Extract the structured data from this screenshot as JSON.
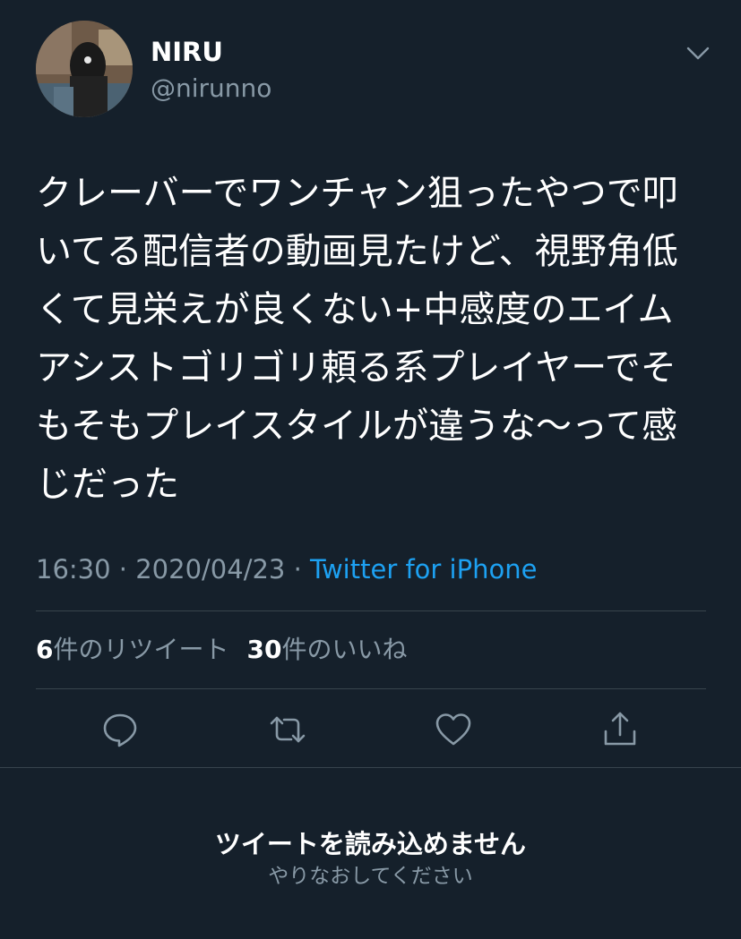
{
  "author": {
    "display_name": "NIRU",
    "handle": "@nirunno"
  },
  "tweet": {
    "text": "クレーバーでワンチャン狙ったやつで叩いてる配信者の動画見たけど、視野角低くて見栄えが良くない+中感度のエイムアシストゴリゴリ頼る系プレイヤーでそもそもプレイスタイルが違うな〜って感じだった",
    "time": "16:30",
    "separator": " · ",
    "date": "2020/04/23",
    "source": "Twitter for iPhone"
  },
  "stats": {
    "retweet_count": "6",
    "retweet_label": "件のリツイート",
    "like_count": "30",
    "like_label": "件のいいね"
  },
  "actions": {
    "reply_icon": "reply-icon",
    "retweet_icon": "retweet-icon",
    "like_icon": "heart-icon",
    "share_icon": "share-icon"
  },
  "error": {
    "title": "ツイートを読み込めません",
    "retry": "やりなおしてください"
  },
  "colors": {
    "background": "#15202b",
    "secondary_text": "#8899a6",
    "link": "#1da1f2",
    "divider": "#38444d"
  }
}
